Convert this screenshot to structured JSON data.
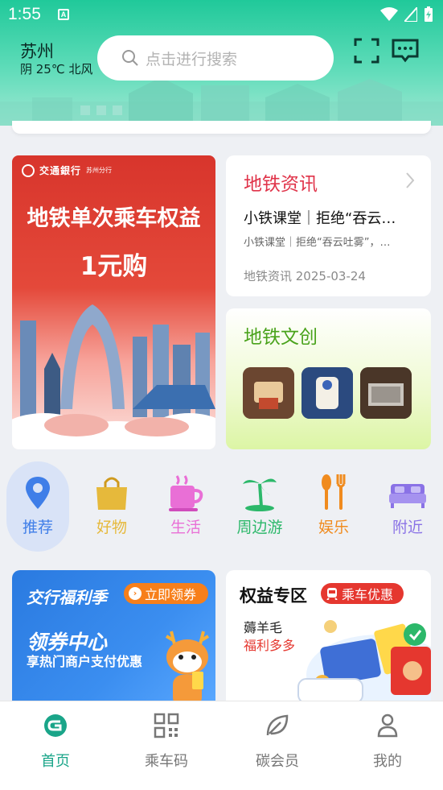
{
  "status": {
    "time": "1:55",
    "notif": "A"
  },
  "header": {
    "city": "苏州",
    "weather": "阴 25℃ 北风",
    "search_placeholder": "点击进行搜索",
    "icons": [
      "scan-icon",
      "message-icon"
    ]
  },
  "banner": {
    "bank_name": "交通銀行",
    "bank_branch": "苏州分行",
    "title": "地铁单次乘车权益",
    "subtitle": "1元购"
  },
  "news": {
    "title": "地铁资讯",
    "headline": "小铁课堂｜拒绝“吞云…",
    "summary": "小铁课堂｜拒绝“吞云吐雾”，…",
    "meta": "地铁资讯 2025-03-24"
  },
  "culture": {
    "title": "地铁文创"
  },
  "categories": [
    {
      "label": "推荐",
      "color": "#3f7ee8",
      "icon": "location-pin-icon"
    },
    {
      "label": "好物",
      "color": "#e6b93b",
      "icon": "shopping-bag-icon"
    },
    {
      "label": "生活",
      "color": "#e96fd6",
      "icon": "coffee-cup-icon"
    },
    {
      "label": "周边游",
      "color": "#2cb86a",
      "icon": "palm-tree-icon"
    },
    {
      "label": "娱乐",
      "color": "#f08b1e",
      "icon": "utensils-icon"
    },
    {
      "label": "附近",
      "color": "#8a72e6",
      "icon": "bed-icon"
    }
  ],
  "promo_left": {
    "brand": "交行福利季",
    "button": "立即领券",
    "title": "领券中心",
    "subtitle": "享热门商户支付优惠"
  },
  "promo_right": {
    "title": "权益专区",
    "badge": "乘车优惠",
    "line1": "薅羊毛",
    "line2": "福利多多"
  },
  "nav": [
    {
      "label": "首页",
      "icon": "home-logo-icon",
      "active": true
    },
    {
      "label": "乘车码",
      "icon": "qr-code-icon",
      "active": false
    },
    {
      "label": "碳会员",
      "icon": "leaf-icon",
      "active": false
    },
    {
      "label": "我的",
      "icon": "user-icon",
      "active": false
    }
  ],
  "colors": {
    "accent": "#1aa589",
    "news_title": "#e0344a",
    "culture_title": "#4aa31c"
  }
}
